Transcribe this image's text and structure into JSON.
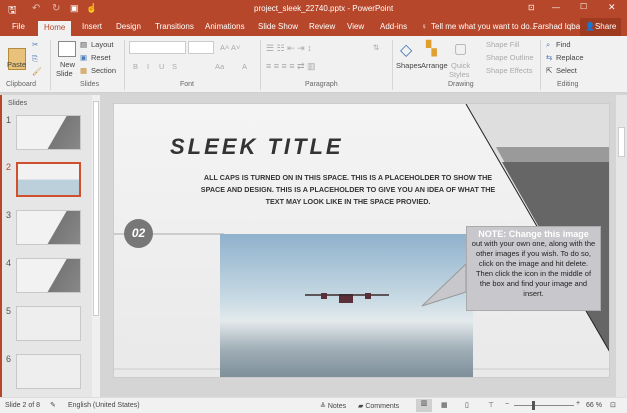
{
  "window": {
    "title": "project_sleek_22740.pptx - PowerPoint",
    "user": "Farshad Iqbal",
    "share": "Share",
    "accent": "#b7472a"
  },
  "tabs": [
    "File",
    "Home",
    "Insert",
    "Design",
    "Transitions",
    "Animations",
    "Slide Show",
    "Review",
    "View",
    "Add-ins"
  ],
  "tell_me": "Tell me what you want to do...",
  "ribbon": {
    "clipboard": {
      "paste": "Paste",
      "label": "Clipboard"
    },
    "slides": {
      "new_slide": "New",
      "new_slide2": "Slide",
      "layout": "Layout",
      "reset": "Reset",
      "section": "Section",
      "label": "Slides"
    },
    "font": {
      "label": "Font",
      "bold": "B",
      "italic": "I",
      "underline": "U",
      "strike": "S",
      "aa": "Aa"
    },
    "paragraph": {
      "label": "Paragraph"
    },
    "drawing": {
      "shapes": "Shapes",
      "arrange": "Arrange",
      "quick": "Quick",
      "styles": "Styles",
      "fill": "Shape Fill",
      "outline": "Shape Outline",
      "effects": "Shape Effects",
      "label": "Drawing"
    },
    "editing": {
      "find": "Find",
      "replace": "Replace",
      "select": "Select",
      "label": "Editing"
    }
  },
  "slides_panel": {
    "header": "Slides",
    "items": [
      "1",
      "2",
      "3",
      "4",
      "5",
      "6"
    ],
    "selected": 2
  },
  "slide": {
    "title": "SLEEK TITLE",
    "body": "ALL CAPS IS TURNED ON IN THIS SPACE. THIS IS A PLACEHOLDER TO SHOW THE SPACE AND DESIGN. THIS IS A PLACEHOLDER TO GIVE YOU AN IDEA OF WHAT THE TEXT MAY LOOK LIKE IN THE SPACE PROVIED.",
    "number": "02",
    "note_bold": "NOTE: Change this image",
    "note_text": "out with your own one, along with the other images if you wish. To do so, click on the image and hit delete. Then click the  icon in the middle of the box and find your image and insert."
  },
  "status": {
    "slide": "Slide 2 of 8",
    "language": "English (United States)",
    "notes": "Notes",
    "comments": "Comments",
    "zoom": "66 %",
    "zoom_level": 66
  }
}
